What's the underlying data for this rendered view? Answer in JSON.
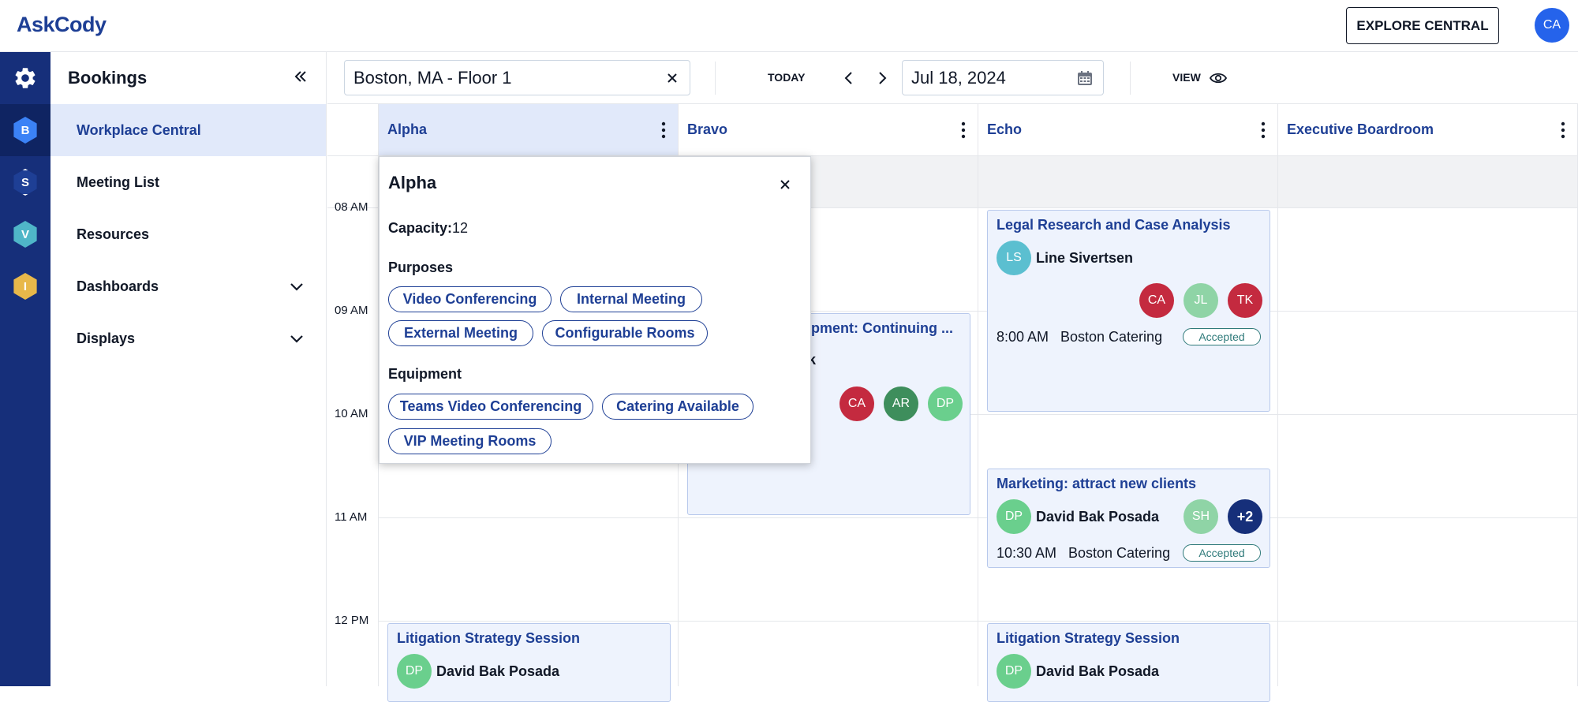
{
  "app": {
    "logo": "AskCody",
    "explore_label": "EXPLORE CENTRAL",
    "user_initials": "CA"
  },
  "rail": {
    "items": [
      {
        "icon": "gear-icon"
      },
      {
        "letter": "B",
        "color": "#3b82f6"
      },
      {
        "letter": "S",
        "color": "#1e3f95"
      },
      {
        "letter": "V",
        "color": "#4fb6c8"
      },
      {
        "letter": "I",
        "color": "#e8b84a"
      }
    ]
  },
  "sidebar": {
    "title": "Bookings",
    "items": [
      {
        "label": "Workplace Central"
      },
      {
        "label": "Meeting List"
      },
      {
        "label": "Resources"
      },
      {
        "label": "Dashboards"
      },
      {
        "label": "Displays"
      }
    ]
  },
  "toolbar": {
    "location": "Boston, MA - Floor 1",
    "today_label": "TODAY",
    "date": "Jul 18, 2024",
    "view_label": "VIEW"
  },
  "grid": {
    "rooms": [
      "Alpha",
      "Bravo",
      "Echo",
      "Executive Boardroom"
    ],
    "times": [
      "08 AM",
      "09 AM",
      "10 AM",
      "11 AM",
      "12 PM"
    ]
  },
  "bookings": {
    "legal": {
      "title": "Legal Research and Case Analysis",
      "organizer_initials": "LS",
      "organizer_color": "#5bbfd0",
      "organizer": "Line Sivertsen",
      "attendees": [
        {
          "initials": "CA",
          "color": "#c42a3f"
        },
        {
          "initials": "JL",
          "color": "#8fd4a6"
        },
        {
          "initials": "TK",
          "color": "#c42a3f"
        }
      ],
      "time": "8:00 AM",
      "location": "Boston Catering",
      "status": "Accepted"
    },
    "bravo": {
      "title": "lopment: Continuing ...",
      "organizer_fragment": "k",
      "attendees": [
        {
          "initials": "CA",
          "color": "#c42a3f"
        },
        {
          "initials": "AR",
          "color": "#3e8e5c"
        },
        {
          "initials": "DP",
          "color": "#6acf8d"
        }
      ]
    },
    "marketing": {
      "title": "Marketing: attract new clients",
      "organizer_initials": "DP",
      "organizer_color": "#6acf8d",
      "organizer": "David Bak Posada",
      "attendees": [
        {
          "initials": "SH",
          "color": "#8fd4a6"
        },
        {
          "initials": "+2",
          "color": "#162f7a"
        }
      ],
      "time": "10:30 AM",
      "location": "Boston Catering",
      "status": "Accepted"
    },
    "litigation_alpha": {
      "title": "Litigation Strategy Session",
      "organizer_initials": "DP",
      "organizer_color": "#6acf8d",
      "organizer": "David Bak Posada"
    },
    "litigation_echo": {
      "title": "Litigation Strategy Session",
      "organizer_initials": "DP",
      "organizer_color": "#6acf8d",
      "organizer": "David Bak Posada"
    }
  },
  "popover": {
    "title": "Alpha",
    "capacity_label": "Capacity:",
    "capacity": "12",
    "purposes_label": "Purposes",
    "purposes": [
      "Video Conferencing",
      "Internal Meeting",
      "External Meeting",
      "Configurable Rooms"
    ],
    "equipment_label": "Equipment",
    "equipment": [
      "Teams Video Conferencing",
      "Catering Available",
      "VIP Meeting Rooms"
    ]
  }
}
